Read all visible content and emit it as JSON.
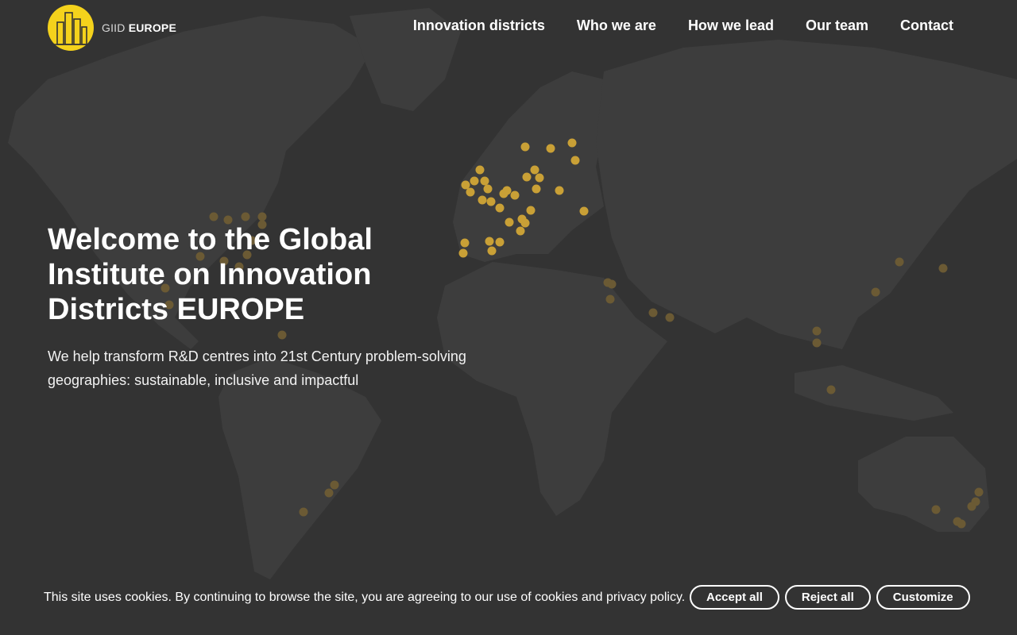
{
  "brand": {
    "name_light": "GIID",
    "name_bold": "EUROPE",
    "accent": "#f4d21c"
  },
  "nav": {
    "items": [
      {
        "label": "Innovation districts"
      },
      {
        "label": "Who we are"
      },
      {
        "label": "How we lead"
      },
      {
        "label": "Our team"
      },
      {
        "label": "Contact"
      }
    ]
  },
  "hero": {
    "title": "Welcome to the Global Institute on Innovation Districts EUROPE",
    "subtitle": "We help transform R&D centres into 21st Century problem-solving geographies: sustainable, inclusive and impactful"
  },
  "map": {
    "background": "#333333",
    "land_color": "#3d3d3d",
    "marker_color": "#c9a036",
    "marker_dim_color": "#6b5a34"
  },
  "cookie": {
    "text": "This site uses cookies. By continuing to browse the site, you are agreeing to our use of cookies and privacy policy.",
    "accept_label": "Accept all",
    "reject_label": "Reject all",
    "customize_label": "Customize"
  }
}
